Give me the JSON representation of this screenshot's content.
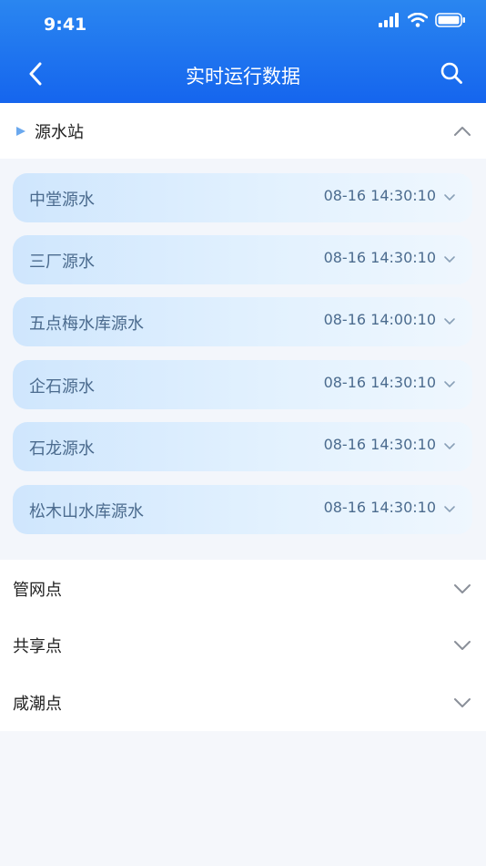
{
  "status_bar": {
    "time": "9:41"
  },
  "nav": {
    "title": "实时运行数据"
  },
  "source_section": {
    "label": "源水站",
    "items": [
      {
        "name": "中堂源水",
        "time": "08-16 14:30:10"
      },
      {
        "name": "三厂源水",
        "time": "08-16 14:30:10"
      },
      {
        "name": "五点梅水库源水",
        "time": "08-16 14:00:10"
      },
      {
        "name": "企石源水",
        "time": "08-16 14:30:10"
      },
      {
        "name": "石龙源水",
        "time": "08-16 14:30:10"
      },
      {
        "name": "松木山水库源水",
        "time": "08-16 14:30:10"
      }
    ]
  },
  "other_sections": [
    {
      "label": "管网点"
    },
    {
      "label": "共享点"
    },
    {
      "label": "咸潮点"
    }
  ],
  "colors": {
    "header_top": "#2a86f0",
    "header_bottom": "#1565ee",
    "card_text": "#4b6b8e",
    "accent_triangle": "#6aa8ee"
  }
}
